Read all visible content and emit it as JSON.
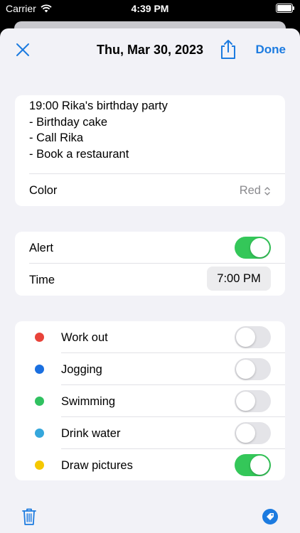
{
  "status_bar": {
    "carrier": "Carrier",
    "time": "4:39 PM"
  },
  "nav": {
    "title": "Thu, Mar 30, 2023",
    "done_label": "Done"
  },
  "note": {
    "text": "19:00 Rika's birthday party\n- Birthday cake\n- Call Rika\n- Book a restaurant",
    "color_label": "Color",
    "color_value": "Red"
  },
  "alert": {
    "label": "Alert",
    "enabled": true,
    "time_label": "Time",
    "time_value": "7:00 PM"
  },
  "habits": [
    {
      "label": "Work out",
      "color": "#e8433a",
      "enabled": false
    },
    {
      "label": "Jogging",
      "color": "#1a6fe0",
      "enabled": false
    },
    {
      "label": "Swimming",
      "color": "#30c160",
      "enabled": false
    },
    {
      "label": "Drink water",
      "color": "#35a7dc",
      "enabled": false
    },
    {
      "label": "Draw pictures",
      "color": "#f5c800",
      "enabled": true
    }
  ],
  "colors": {
    "accent": "#1c7be0",
    "toggle_on": "#34c759"
  },
  "icons": {
    "close": "close-icon",
    "share": "share-icon",
    "trash": "trash-icon",
    "tag": "tag-icon",
    "chevron": "updown-chevron-icon"
  }
}
